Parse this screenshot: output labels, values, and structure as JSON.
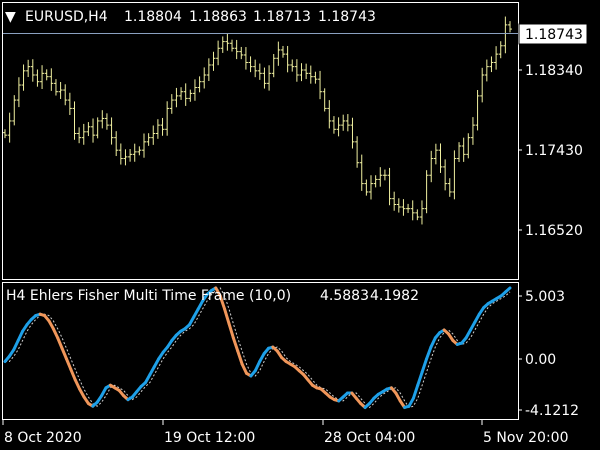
{
  "main_header": {
    "arrow_glyph": "▼",
    "symbol": "EURUSD,H4",
    "open": "1.18804",
    "high": "1.18863",
    "low": "1.18713",
    "close": "1.18743"
  },
  "main_axis": {
    "tick_labels": [
      "1.18340",
      "1.17430",
      "1.16520"
    ],
    "current_price": "1.18743"
  },
  "indicator_header": {
    "name": "H4 Ehlers Fisher Multi Time Frame (10,0)",
    "value1": "4.5883",
    "value2": "4.1982"
  },
  "indicator_axis": {
    "tick_labels": [
      "5.003",
      "0.00",
      "-4.1212"
    ]
  },
  "time_axis": {
    "labels": [
      "8 Oct 2020",
      "19 Oct 12:00",
      "28 Oct 04:00",
      "5 Nov 20:00"
    ]
  },
  "colors": {
    "background": "#000000",
    "frame": "#ffffff",
    "bar": "#f0f0a0",
    "fisher_up": "#1ea0e8",
    "fisher_down": "#f0965a",
    "signal": "#cfcfcf",
    "current_line": "#8aa0c0"
  },
  "chart_data": [
    {
      "type": "ohlc",
      "series": [
        {
          "name": "EURUSD,H4"
        }
      ],
      "ylim": [
        1.1577,
        1.1905
      ],
      "close": [
        1.1748,
        1.1765,
        1.179,
        1.1808,
        1.1825,
        1.183,
        1.182,
        1.1812,
        1.1822,
        1.1818,
        1.181,
        1.18,
        1.1802,
        1.179,
        1.178,
        1.175,
        1.1745,
        1.1752,
        1.1758,
        1.1748,
        1.1765,
        1.1768,
        1.176,
        1.1745,
        1.173,
        1.172,
        1.1722,
        1.1725,
        1.1728,
        1.173,
        1.174,
        1.1745,
        1.175,
        1.176,
        1.1755,
        1.178,
        1.179,
        1.1795,
        1.18,
        1.1792,
        1.1798,
        1.1805,
        1.1812,
        1.182,
        1.1832,
        1.184,
        1.1852,
        1.186,
        1.1858,
        1.1852,
        1.1848,
        1.1844,
        1.1835,
        1.183,
        1.1825,
        1.1822,
        1.181,
        1.1822,
        1.184,
        1.185,
        1.1845,
        1.1832,
        1.183,
        1.182,
        1.1826,
        1.1822,
        1.1818,
        1.1815,
        1.18,
        1.178,
        1.1765,
        1.1755,
        1.176,
        1.1765,
        1.176,
        1.174,
        1.1715,
        1.169,
        1.168,
        1.169,
        1.1695,
        1.17,
        1.17,
        1.1672,
        1.1665,
        1.1662,
        1.166,
        1.166,
        1.1655,
        1.165,
        1.166,
        1.17,
        1.172,
        1.173,
        1.171,
        1.169,
        1.168,
        1.172,
        1.1735,
        1.1725,
        1.1745,
        1.176,
        1.1795,
        1.182,
        1.183,
        1.1835,
        1.1845,
        1.1855,
        1.188,
        1.1875
      ]
    },
    {
      "type": "line",
      "series": [
        {
          "name": "H4 Ehlers Fisher Multi Time Frame (10,0)"
        }
      ],
      "ylim": [
        -4.9,
        5.3
      ],
      "values": [
        -0.6,
        -0.2,
        0.3,
        1.0,
        1.7,
        2.2,
        2.6,
        2.9,
        3.0,
        2.9,
        2.5,
        1.9,
        1.2,
        0.4,
        -0.4,
        -1.2,
        -2.0,
        -2.7,
        -3.3,
        -3.8,
        -4.0,
        -3.7,
        -3.2,
        -2.6,
        -2.4,
        -2.6,
        -2.8,
        -3.2,
        -3.5,
        -3.3,
        -2.9,
        -2.5,
        -2.2,
        -1.6,
        -1.0,
        -0.4,
        0.1,
        0.5,
        1.0,
        1.4,
        1.7,
        1.9,
        2.2,
        2.8,
        3.4,
        4.0,
        4.5,
        4.8,
        5.0,
        4.4,
        3.4,
        2.3,
        1.2,
        0.2,
        -0.8,
        -1.5,
        -1.7,
        -1.3,
        -0.6,
        0.0,
        0.4,
        0.5,
        0.2,
        -0.3,
        -0.6,
        -0.8,
        -1.0,
        -1.3,
        -1.6,
        -2.0,
        -2.4,
        -2.6,
        -2.7,
        -3.0,
        -3.3,
        -3.5,
        -3.6,
        -3.3,
        -3.0,
        -3.0,
        -3.4,
        -3.8,
        -4.1,
        -3.8,
        -3.4,
        -3.1,
        -2.9,
        -2.7,
        -2.6,
        -3.0,
        -3.6,
        -4.1,
        -4.0,
        -3.4,
        -2.4,
        -1.4,
        -0.4,
        0.5,
        1.2,
        1.6,
        1.8,
        1.5,
        1.0,
        0.7,
        0.8,
        1.2,
        1.8,
        2.4,
        3.0,
        3.5,
        3.8,
        4.0,
        4.2,
        4.4,
        4.7,
        5.0
      ]
    }
  ]
}
